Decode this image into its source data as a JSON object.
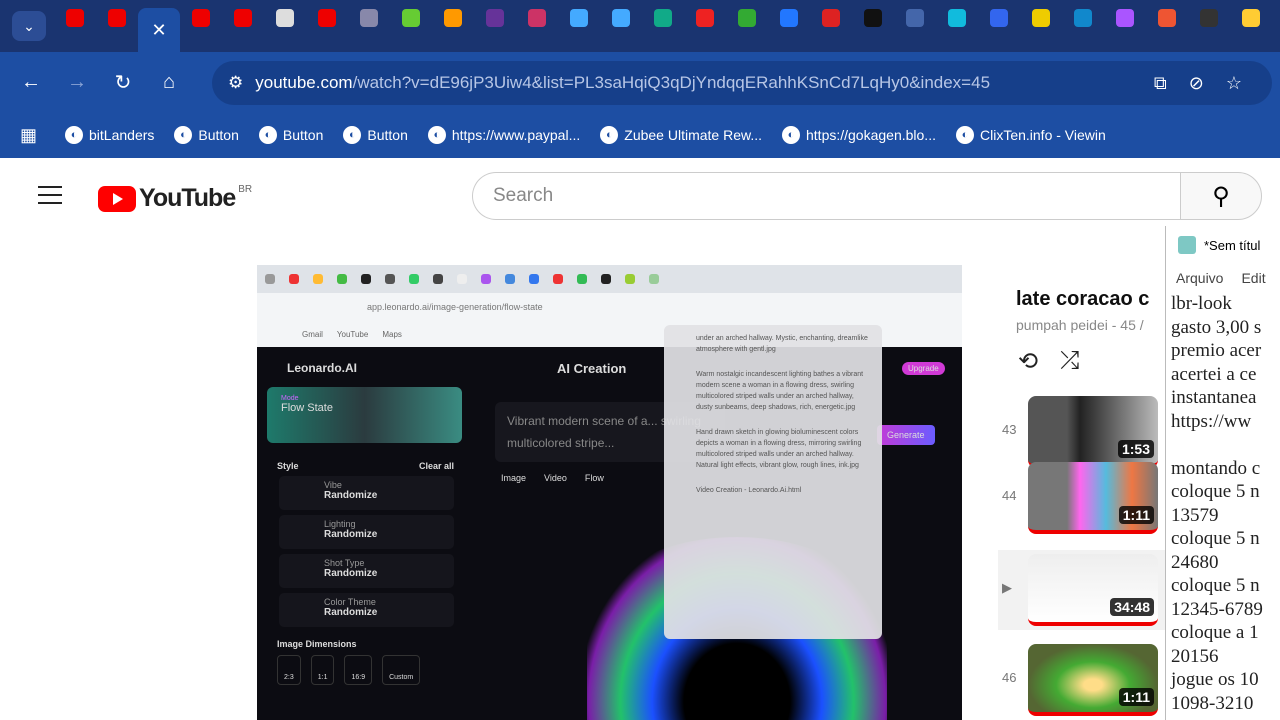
{
  "browser": {
    "tab_list_icon": "chevron-down-icon",
    "tab_count": 27,
    "url_domain": "youtube.com",
    "url_path": "/watch?v=dE96jP3Uiw4&list=PL3saHqiQ3qDjYndqqERahhKSnCd7LqHy0&index=45",
    "bookmarks": [
      "bitLanders",
      "Button",
      "Button",
      "Button",
      "https://www.paypal...",
      "Zubee Ultimate Rew...",
      "https://gokagen.blo...",
      "ClixTen.info - Viewin"
    ]
  },
  "youtube": {
    "logo": "YouTube",
    "country": "BR",
    "search_placeholder": "Search",
    "playlist": {
      "title": "late coracao c",
      "subtitle": "pumpah peidei - 45 /",
      "items": [
        {
          "index": "43",
          "duration": "1:53"
        },
        {
          "index": "44",
          "duration": "1:11"
        },
        {
          "index": "▶",
          "duration": "34:48"
        },
        {
          "index": "46",
          "duration": "1:11"
        }
      ]
    }
  },
  "video": {
    "url": "app.leonardo.ai/image-generation/flow-state",
    "bookmarks": [
      "Gmail",
      "YouTube",
      "Maps"
    ],
    "brand": "Leonardo.AI",
    "heading": "AI Creation",
    "upgrade": "Upgrade",
    "generate": "Generate",
    "flow_label": "Mode",
    "flow_value": "Flow State",
    "prompt": "Vibrant modern scene of a... swirling multicolored stripe...",
    "modes": [
      "Image",
      "Video",
      "Flow"
    ],
    "style_label": "Style",
    "clear_all": "Clear all",
    "styles": [
      {
        "label": "Vibe",
        "value": "Randomize"
      },
      {
        "label": "Lighting",
        "value": "Randomize"
      },
      {
        "label": "Shot Type",
        "value": "Randomize"
      },
      {
        "label": "Color Theme",
        "value": "Randomize"
      }
    ],
    "dimensions_label": "Image Dimensions",
    "dimensions": [
      "2:3",
      "1:1",
      "16:9",
      "Custom"
    ],
    "downloads": [
      "under an arched hallway. Mystic, enchanting, dreamlike atmosphere with gentl.jpg",
      "Warm nostalgic incandescent lighting bathes a vibrant modern scene a woman in a flowing dress, swirling multicolored striped walls under an arched hallway, dusty sunbeams, deep shadows, rich, energetic.jpg",
      "Hand drawn sketch in glowing bioluminescent colors depicts a woman in a flowing dress, mirroring swirling multicolored striped walls under an arched hallway. Natural light effects, vibrant glow, rough lines, ink.jpg",
      "Video Creation - Leonardo.Ai.html"
    ]
  },
  "notepad": {
    "title": "*Sem títul",
    "menu": [
      "Arquivo",
      "Edit"
    ],
    "lines": [
      "lbr-look",
      "gasto 3,00 s",
      "premio acer",
      "acertei a ce",
      "instantanea",
      "https://ww",
      "",
      "montando c",
      "coloque 5 n",
      "13579",
      "coloque 5 n",
      "24680",
      "coloque 5 n",
      "12345-6789",
      "coloque a 1",
      "20156",
      "jogue os 10",
      "1098-3210"
    ]
  }
}
